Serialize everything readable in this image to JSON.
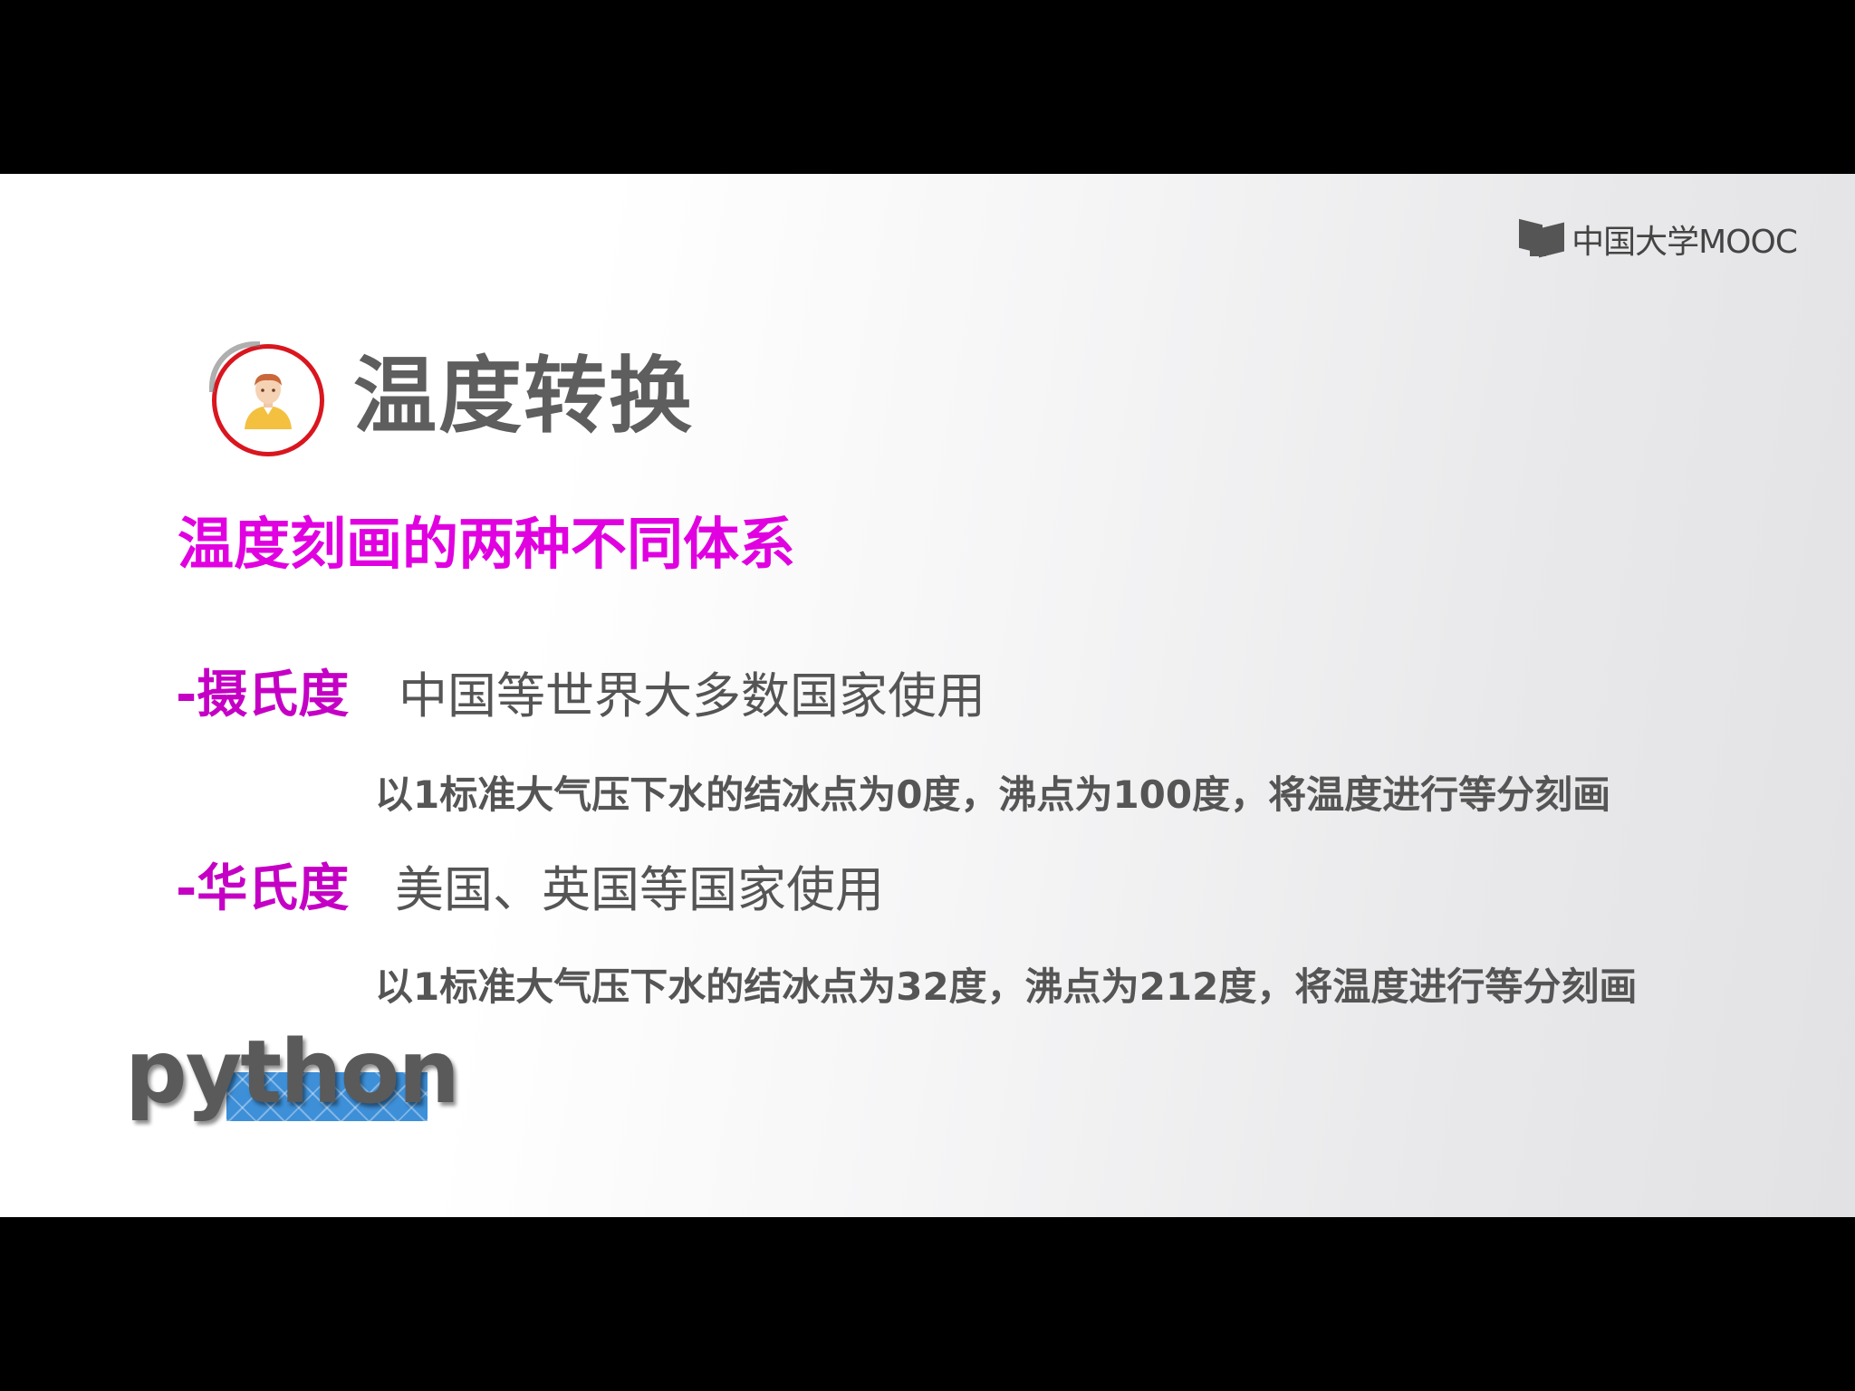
{
  "logo": {
    "text": "中国大学MOOC"
  },
  "title": "温度转换",
  "subtitle": "温度刻画的两种不同体系",
  "items": [
    {
      "label": "-摄氏度",
      "text": "中国等世界大多数国家使用",
      "detail": "以1标准大气压下水的结冰点为0度，沸点为100度，将温度进行等分刻画"
    },
    {
      "label": "-华氏度",
      "text": "美国、英国等国家使用",
      "detail": "以1标准大气压下水的结冰点为32度，沸点为212度，将温度进行等分刻画"
    }
  ],
  "python_logo": {
    "text": "python"
  },
  "colors": {
    "accent": "#e000e0",
    "title": "#5e5e5e",
    "ring": "#d9161f",
    "python_band": "#3d8fd8"
  },
  "icons": [
    "book-logo-icon",
    "person-avatar-icon"
  ]
}
